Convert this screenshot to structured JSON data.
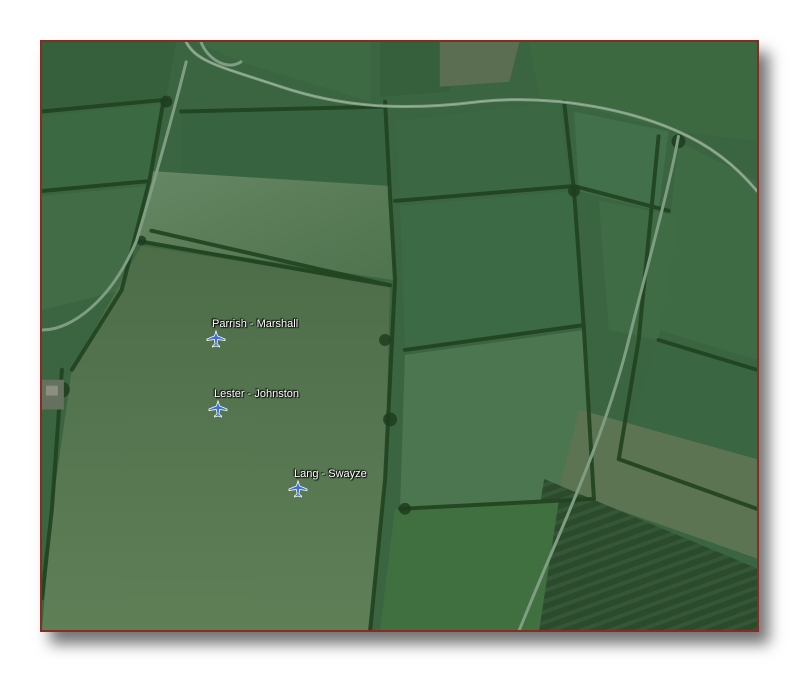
{
  "map": {
    "type": "satellite",
    "colors": {
      "frame_border": "#8b2a22",
      "field_dark": "#35603a",
      "field_light": "#5b7d52",
      "hedge": "#21431f",
      "road": "#7d9a80",
      "marker": "#3d6fe0"
    },
    "markers": [
      {
        "label": "Parrish - Marshall",
        "icon": "airplane-icon"
      },
      {
        "label": "Lester - Johnston",
        "icon": "airplane-icon"
      },
      {
        "label": "Lang - Swayze",
        "icon": "airplane-icon"
      }
    ]
  }
}
